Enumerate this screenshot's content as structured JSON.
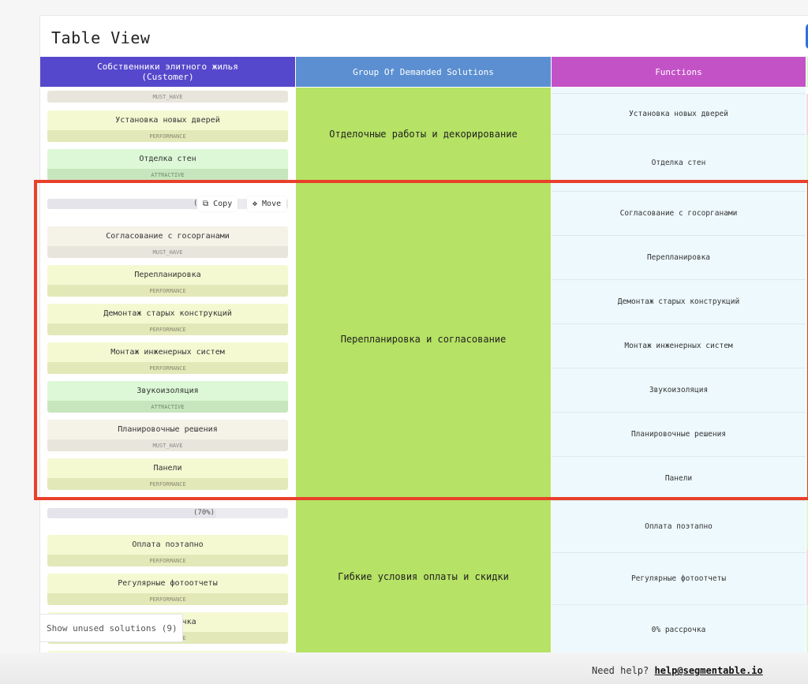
{
  "page": {
    "title": "Table View"
  },
  "columns": {
    "customer": "Собственники элитного жилья\n(Customer)",
    "group": "Group Of Demanded Solutions",
    "functions": "Functions"
  },
  "groups": [
    {
      "name": "Отделочные работы и декорирование"
    },
    {
      "name": "Перепланировка и согласование",
      "progress_percent": 70,
      "progress_label": "(70%)"
    },
    {
      "name": "Гибкие условия оплаты и скидки",
      "progress_percent": 70,
      "progress_label": "(70%)"
    }
  ],
  "solutions": {
    "top_partial_tag": "MUST_HAVE",
    "group1": [
      {
        "name": "Установка новых дверей",
        "tag": "PERFORMANCE"
      },
      {
        "name": "Отделка стен",
        "tag": "ATTRACTIVE"
      }
    ],
    "group2": [
      {
        "name": "Согласование с госорганами",
        "tag": "MUST_HAVE"
      },
      {
        "name": "Перепланировка",
        "tag": "PERFORMANCE"
      },
      {
        "name": "Демонтаж старых конструкций",
        "tag": "PERFORMANCE"
      },
      {
        "name": "Монтаж инженерных систем",
        "tag": "PERFORMANCE"
      },
      {
        "name": "Звукоизоляция",
        "tag": "ATTRACTIVE"
      },
      {
        "name": "Планировочные решения",
        "tag": "MUST_HAVE"
      },
      {
        "name": "Панели",
        "tag": "PERFORMANCE"
      }
    ],
    "group3": [
      {
        "name": "Оплата поэтапно",
        "tag": "PERFORMANCE"
      },
      {
        "name": "Регулярные фотоотчеты",
        "tag": "PERFORMANCE"
      },
      {
        "name": "0% рассрочка",
        "tag": "PERFORMANCE",
        "partial_text": "очка",
        "partial_tag": "NCE"
      }
    ]
  },
  "functions": [
    "Установка новых дверей",
    "Отделка стен",
    "Согласование с госорганами",
    "Перепланировка",
    "Демонтаж старых конструкций",
    "Монтаж инженерных систем",
    "Звукоизоляция",
    "Планировочные решения",
    "Панели",
    "Оплата поэтапно",
    "Регулярные фотоотчеты",
    "0% рассрочка"
  ],
  "floating": {
    "copy_label": "Copy",
    "move_label": "Move",
    "copy_icon": "copy-icon",
    "move_icon": "move-icon",
    "hidden_progress_fragment": "(7"
  },
  "unused_button": "Show unused solutions (9)",
  "footer": {
    "help_text": "Need help?",
    "email": "help@segmentable.io"
  },
  "colors": {
    "customer_header": "#5648cc",
    "group_header": "#5b8fd1",
    "functions_header": "#c452c7",
    "group_cell": "#b6e265",
    "highlight": "#e8402a"
  }
}
